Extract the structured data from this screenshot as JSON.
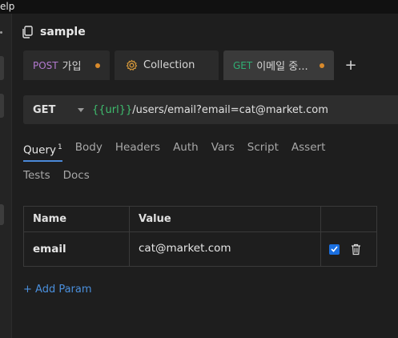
{
  "menubar": {
    "text": "elp"
  },
  "collection": {
    "name": "sample",
    "icon": "copy-icon"
  },
  "tabs": [
    {
      "method": "POST",
      "label": "가입",
      "unsaved": true
    },
    {
      "label": "Collection",
      "icon": "gear-icon"
    },
    {
      "method": "GET",
      "label": "이메일 중...",
      "unsaved": true,
      "active": true
    }
  ],
  "new_tab": {
    "label": "+"
  },
  "request": {
    "method": "GET",
    "url_variable": "{{url}}",
    "url_path": "/users/email?email=cat@market.com"
  },
  "request_tabs": {
    "row1": [
      {
        "label": "Query",
        "badge": "1",
        "active": true
      },
      {
        "label": "Body"
      },
      {
        "label": "Headers"
      },
      {
        "label": "Auth"
      },
      {
        "label": "Vars"
      },
      {
        "label": "Script"
      },
      {
        "label": "Assert"
      }
    ],
    "row2": [
      {
        "label": "Tests"
      },
      {
        "label": "Docs"
      }
    ]
  },
  "params": {
    "headers": {
      "name": "Name",
      "value": "Value"
    },
    "rows": [
      {
        "name": "email",
        "value": "cat@market.com",
        "enabled": true
      }
    ]
  },
  "add_param": {
    "label": "+ Add Param"
  },
  "colors": {
    "accent": "#4a89d8",
    "post": "#b37ad0",
    "get": "#2fae73",
    "variable": "#3fbf6f",
    "unsaved_dot": "#d98a2b",
    "checkbox": "#1a6fe0"
  }
}
